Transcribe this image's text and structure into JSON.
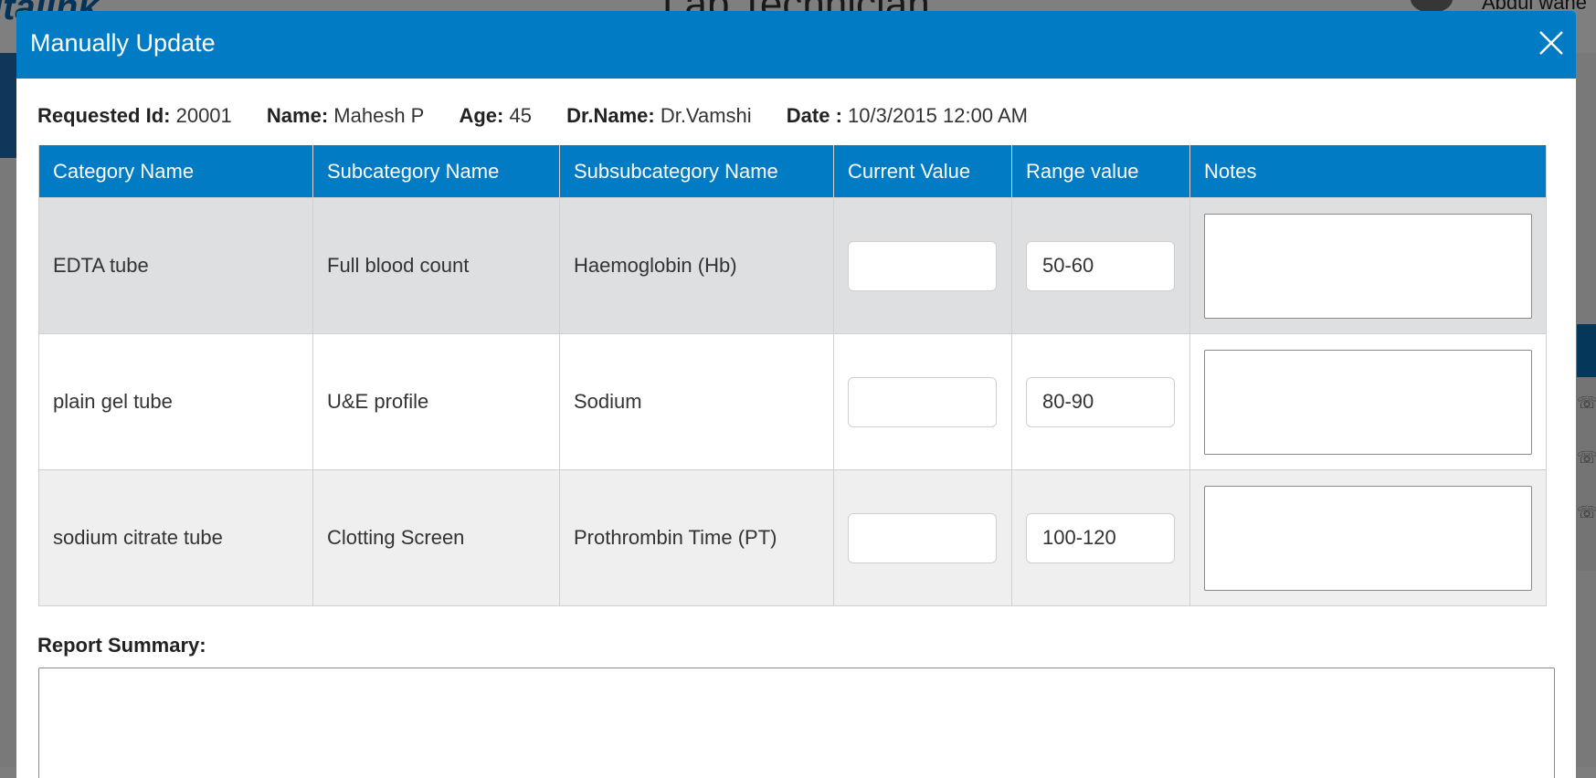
{
  "background": {
    "logo_text": "italink",
    "page_title": "Lab Technician",
    "user_name": "Abdul wahe"
  },
  "modal": {
    "title": "Manually Update",
    "close_icon": "close-icon"
  },
  "request_info": {
    "requested_id_label": "Requested Id:",
    "requested_id": "20001",
    "name_label": "Name:",
    "name": "Mahesh P",
    "age_label": "Age:",
    "age": "45",
    "doctor_label": "Dr.Name:",
    "doctor": "Dr.Vamshi",
    "date_label": "Date :",
    "date": "10/3/2015 12:00 AM"
  },
  "table": {
    "headers": [
      "Category Name",
      "Subcategory Name",
      "Subsubcategory Name",
      "Current Value",
      "Range value",
      "Notes"
    ],
    "rows": [
      {
        "category": "EDTA tube",
        "subcategory": "Full blood count",
        "subsubcategory": "Haemoglobin (Hb)",
        "current_value": "",
        "range_value": "50-60",
        "notes": ""
      },
      {
        "category": "plain gel tube",
        "subcategory": "U&E profile",
        "subsubcategory": "Sodium",
        "current_value": "",
        "range_value": "80-90",
        "notes": ""
      },
      {
        "category": "sodium citrate tube",
        "subcategory": "Clotting Screen",
        "subsubcategory": "Prothrombin Time (PT)",
        "current_value": "",
        "range_value": "100-120",
        "notes": ""
      }
    ]
  },
  "report_summary": {
    "label": "Report Summary:",
    "value": ""
  },
  "colors": {
    "primary": "#007bc4",
    "row_shaded": "#dedfe0",
    "row_alt": "#efeff0"
  }
}
